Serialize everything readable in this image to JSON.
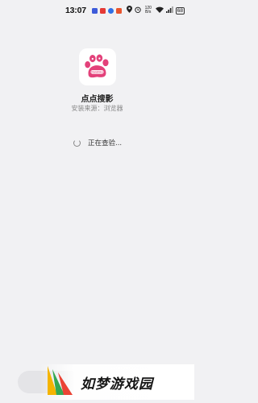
{
  "status_bar": {
    "time": "13:07",
    "net_speed_value": "120",
    "net_speed_unit": "B/s",
    "battery": "68",
    "notification_icons": [
      {
        "name": "grid-app-icon",
        "color": "#3d5bd9"
      },
      {
        "name": "red-app-icon",
        "color": "#e53935"
      },
      {
        "name": "blue-app-icon",
        "color": "#2f6fe6"
      },
      {
        "name": "orange-app-icon",
        "color": "#e8542d"
      }
    ]
  },
  "app": {
    "name": "点点搜影",
    "install_source": "安装来源：浏览器",
    "icon": "paw-app-icon",
    "icon_text": "Ranzhiku",
    "brand_color": "#e3417a"
  },
  "progress": {
    "text": "正在查验..."
  },
  "watermark": {
    "text": "如梦游戏园"
  }
}
